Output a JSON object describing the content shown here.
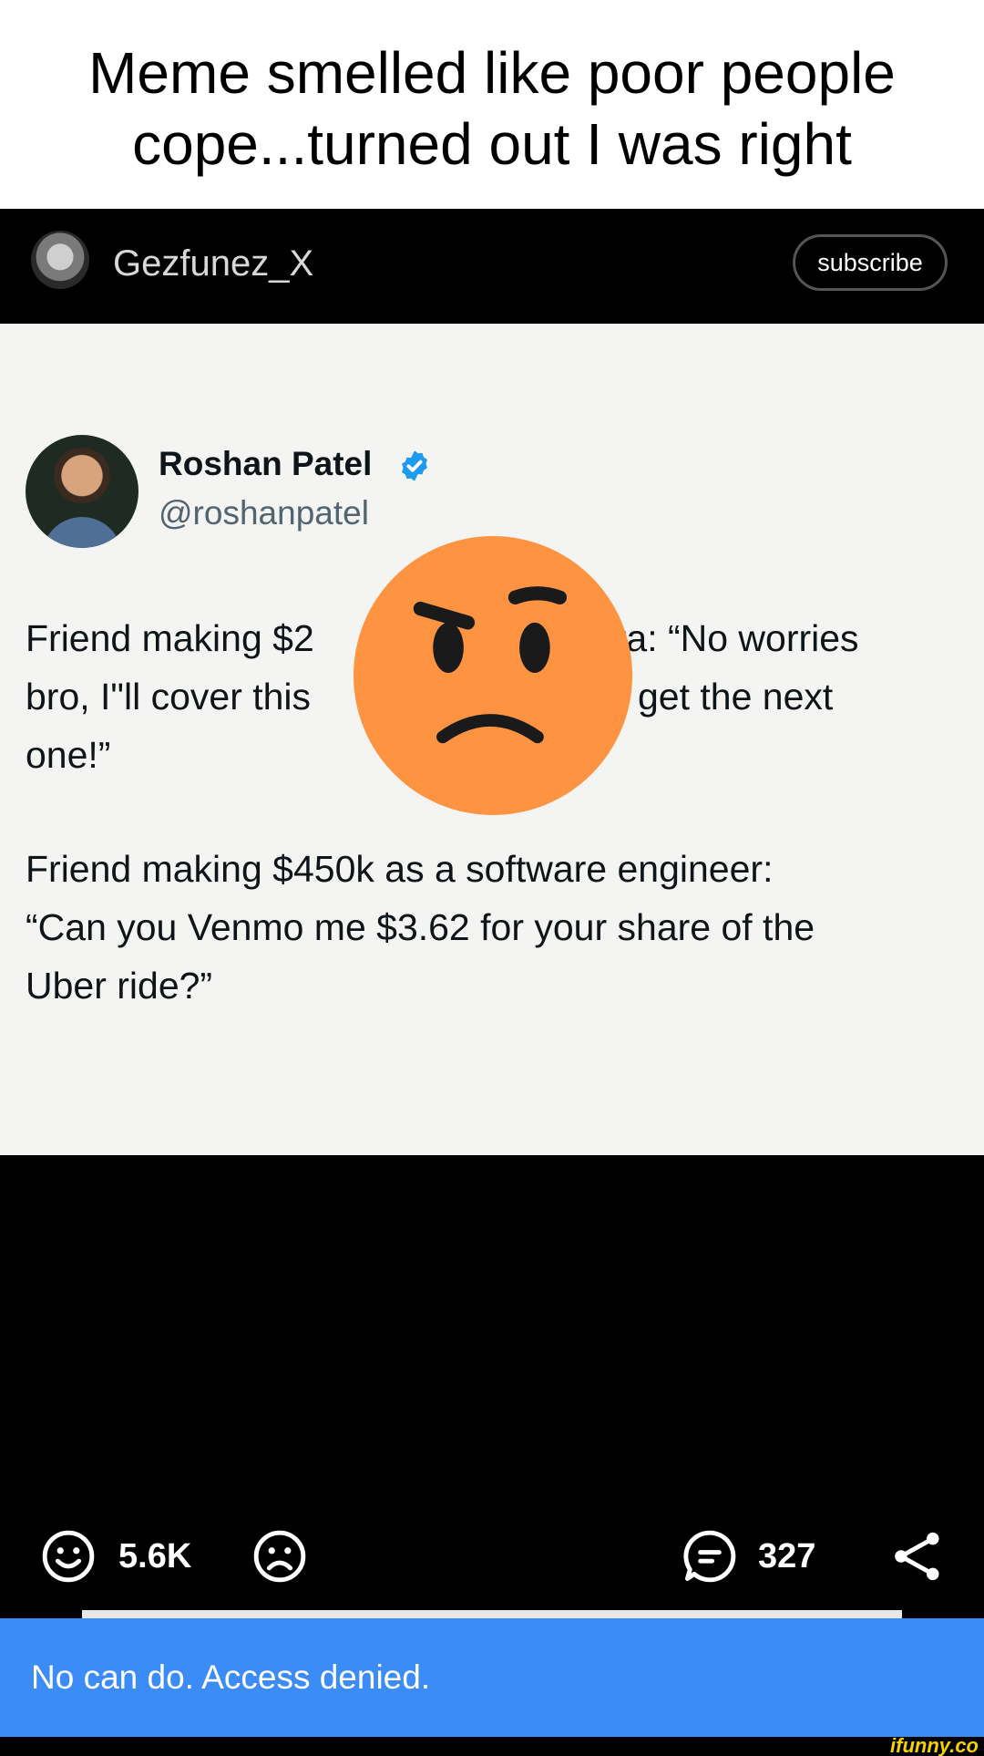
{
  "caption": {
    "line1": "Meme smelled like poor people",
    "line2": "cope...turned out I was right"
  },
  "header": {
    "username": "Gezfunez_X",
    "subscribe_label": "subscribe"
  },
  "tweet": {
    "name": "Roshan Patel",
    "handle": "@roshanpatel",
    "paragraph1_before": "Friend making $2",
    "paragraph1_right1": "ta: “No worries",
    "paragraph1_line2_left": "bro, I\"ll cover this",
    "paragraph1_line2_right": "get the next",
    "paragraph1_line3": "one!”",
    "paragraph2": [
      "Friend making $450k as a software engineer:",
      "“Can you Venmo me $3.62 for your share of the",
      "Uber ride?”"
    ]
  },
  "actions": {
    "likes": "5.6K",
    "comments": "327"
  },
  "toast": {
    "message": "No can do. Access denied."
  },
  "watermark": "ifunny.co",
  "colors": {
    "toast_bg": "#3b8cf7",
    "emoji": "#fe9442",
    "verified": "#1d9bf0"
  }
}
